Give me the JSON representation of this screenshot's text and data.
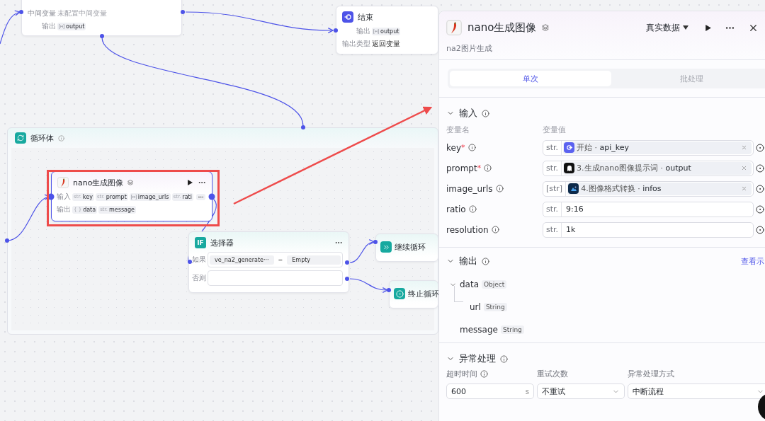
{
  "canvas": {
    "nodes": [
      {
        "kind": "partial",
        "rows": [
          {
            "label": "中间变量",
            "placeholder": "未配置中间变量"
          },
          {
            "label": "输出",
            "tags": [
              {
                "kind": "array",
                "name": "output"
              }
            ]
          }
        ]
      },
      {
        "kind": "end",
        "title": "结束",
        "rows": [
          {
            "label": "输出",
            "tags": [
              {
                "kind": "array",
                "name": "output"
              }
            ]
          },
          {
            "label": "输出类型",
            "value": "返回变量"
          }
        ]
      },
      {
        "kind": "loop",
        "title": "循环体"
      },
      {
        "kind": "tool",
        "title": "nano生成图像",
        "selected": true,
        "rows": [
          {
            "label": "输入",
            "tags": [
              {
                "kind": "str",
                "prefix": "str.",
                "name": "key"
              },
              {
                "kind": "str",
                "prefix": "str.",
                "name": "prompt"
              },
              {
                "kind": "array",
                "name": "image_urls"
              },
              {
                "kind": "str",
                "prefix": "str.",
                "name": "rati"
              }
            ],
            "more": true
          },
          {
            "label": "输出",
            "tags": [
              {
                "kind": "object",
                "prefix": "{ }",
                "name": "data"
              },
              {
                "kind": "str",
                "prefix": "str.",
                "name": "message"
              }
            ]
          }
        ]
      },
      {
        "kind": "selector",
        "title": "选择器",
        "badge": "IF",
        "rows": [
          {
            "label": "如果",
            "left": "ve_na2_generate···",
            "op": "=",
            "right": "Empty"
          },
          {
            "label": "否则"
          }
        ]
      },
      {
        "kind": "continue",
        "title": "继续循环"
      },
      {
        "kind": "stop",
        "title": "终止循环"
      }
    ]
  },
  "panel": {
    "title": "nano生成图像",
    "mode": "真实数据",
    "subtitle": "na2图片生成",
    "tabs": [
      {
        "label": "单次",
        "selected": true
      },
      {
        "label": "批处理",
        "selected": false
      }
    ],
    "input": {
      "title": "输入",
      "columns": [
        "变量名",
        "变量值"
      ],
      "rows": [
        {
          "name": "key",
          "mark": "*",
          "type": "str.",
          "source": {
            "kind": "start",
            "label": "开始 · **api_key**"
          }
        },
        {
          "name": "prompt",
          "mark": "*",
          "type": "str.",
          "source": {
            "kind": "llm",
            "label": "3.生成nano图像提示词 · **output**"
          }
        },
        {
          "name": "image_urls",
          "type": "[str]",
          "source": {
            "kind": "image",
            "label": "4.图像格式转换 · **infos**"
          }
        },
        {
          "name": "ratio",
          "type": "str.",
          "value": "9:16"
        },
        {
          "name": "resolution",
          "type": "str.",
          "value": "1k"
        }
      ]
    },
    "output": {
      "title": "输出",
      "link": "查看示",
      "fields": [
        {
          "name": "data",
          "type": "Object",
          "expanded": true,
          "children": [
            {
              "name": "url",
              "type": "String"
            }
          ]
        },
        {
          "name": "message",
          "type": "String"
        }
      ]
    },
    "error": {
      "title": "异常处理",
      "fields": [
        {
          "kind": "input",
          "label": "超时时间",
          "info": true,
          "value": "600",
          "unit": "s"
        },
        {
          "kind": "select",
          "label": "重试次数",
          "value": "不重试"
        },
        {
          "kind": "select",
          "label": "异常处理方式",
          "value": "中断流程"
        }
      ]
    }
  }
}
